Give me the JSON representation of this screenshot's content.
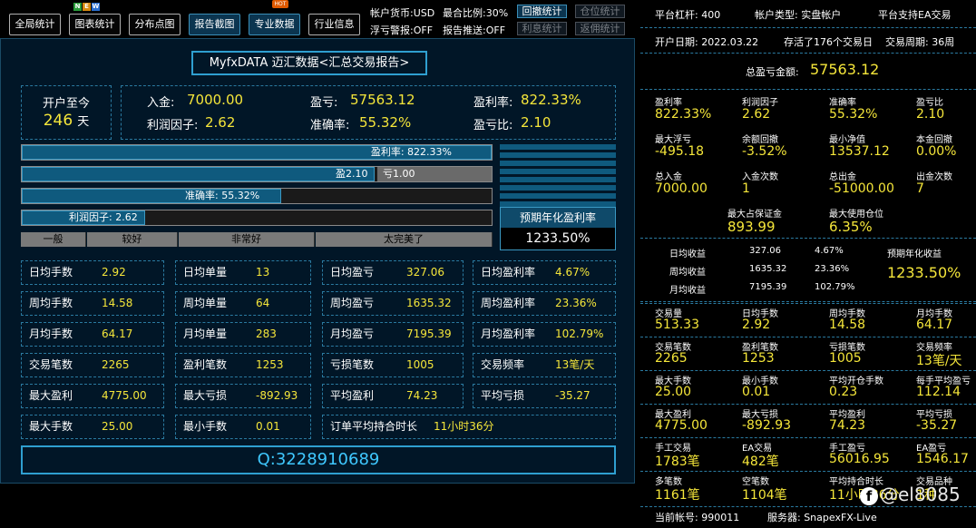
{
  "toolbar": {
    "buttons": [
      "全局统计",
      "图表统计",
      "分布点图",
      "报告截图",
      "专业数据",
      "行业信息"
    ],
    "new_badge": [
      "N",
      "E",
      "W"
    ],
    "hot_badge": "HOT",
    "account_currency": "帐户货币:USD",
    "max_ratio": "最合比例:30%",
    "float_alert": "浮亏警报:OFF",
    "report_push": "报告推送:OFF",
    "small_buttons": [
      "回撤统计",
      "仓位统计",
      "利息统计",
      "返佣统计"
    ]
  },
  "main": {
    "title": "MyfxDATA 迈汇数据<汇总交易报告>",
    "since_open_label": "开户至今",
    "days_value": "246",
    "days_unit": "天",
    "summary": {
      "deposit_label": "入金:",
      "deposit_value": "7000.00",
      "profit_label": "盈亏:",
      "profit_value": "57563.12",
      "profit_rate_label": "盈利率:",
      "profit_rate_value": "822.33%",
      "profit_factor_label": "利润因子:",
      "profit_factor_value": "2.62",
      "accuracy_label": "准确率:",
      "accuracy_value": "55.32%",
      "win_loss_label": "盈亏比:",
      "win_loss_value": "2.10"
    },
    "bars": {
      "profit_rate_text": "盈利率: 822.33%",
      "profit_rate_fill": 1.0,
      "win_text": "盈2.10",
      "loss_text": "亏1.00",
      "win_fill": 0.75,
      "accuracy_text": "准确率: 55.32%",
      "accuracy_fill": 0.553,
      "profit_factor_text": "利润因子: 2.62",
      "profit_factor_fill": 0.262
    },
    "grades": [
      "一般",
      "较好",
      "非常好",
      "太完美了"
    ],
    "annual": {
      "label": "预期年化盈利率",
      "value": "1233.50%"
    },
    "stats": [
      [
        [
          "日均手数",
          "2.92"
        ],
        [
          "日均单量",
          "13"
        ],
        [
          "日均盈亏",
          "327.06"
        ],
        [
          "日均盈利率",
          "4.67%"
        ]
      ],
      [
        [
          "周均手数",
          "14.58"
        ],
        [
          "周均单量",
          "64"
        ],
        [
          "周均盈亏",
          "1635.32"
        ],
        [
          "周均盈利率",
          "23.36%"
        ]
      ],
      [
        [
          "月均手数",
          "64.17"
        ],
        [
          "月均单量",
          "283"
        ],
        [
          "月均盈亏",
          "7195.39"
        ],
        [
          "月均盈利率",
          "102.79%"
        ]
      ],
      [
        [
          "交易笔数",
          "2265"
        ],
        [
          "盈利笔数",
          "1253"
        ],
        [
          "亏损笔数",
          "1005"
        ],
        [
          "交易频率",
          "13笔/天"
        ]
      ],
      [
        [
          "最大盈利",
          "4775.00"
        ],
        [
          "最大亏损",
          "-892.93"
        ],
        [
          "平均盈利",
          "74.23"
        ],
        [
          "平均亏损",
          "-35.27"
        ]
      ]
    ],
    "last_row": {
      "max_lots_label": "最大手数",
      "max_lots_value": "25.00",
      "min_lots_label": "最小手数",
      "min_lots_value": "0.01",
      "avg_hold_label": "订单平均持合时长",
      "avg_hold_value": "11小时36分"
    },
    "qq": "Q:3228910689"
  },
  "right": {
    "leverage": "平台杠杆: 400",
    "account_type": "帐户类型: 实盘帐户",
    "ea_support": "平台支持EA交易",
    "open_date": "开户日期: 2022.03.22",
    "survival": "存活了176个交易日",
    "period": "交易周期: 36周",
    "total_profit_label": "总盈亏金额:",
    "total_profit_value": "57563.12",
    "grid1": [
      [
        [
          "盈利率",
          "822.33%"
        ],
        [
          "利润因子",
          "2.62"
        ],
        [
          "准确率",
          "55.32%"
        ],
        [
          "盈亏比",
          "2.10"
        ]
      ],
      [
        [
          "最大浮亏",
          "-495.18"
        ],
        [
          "余额回撤",
          "-3.52%"
        ],
        [
          "最小净值",
          "13537.12"
        ],
        [
          "本金回撤",
          "0.00%"
        ]
      ],
      [
        [
          "总入金",
          "7000.00"
        ],
        [
          "入金次数",
          "1"
        ],
        [
          "总出金",
          "-51000.00"
        ],
        [
          "出金次数",
          "7"
        ]
      ]
    ],
    "margin_label": "最大占保证金",
    "margin_value": "893.99",
    "max_pos_label": "最大使用仓位",
    "max_pos_value": "6.35%",
    "earnings": [
      [
        "日均收益",
        "327.06",
        "4.67%"
      ],
      [
        "周均收益",
        "1635.32",
        "23.36%"
      ],
      [
        "月均收益",
        "7195.39",
        "102.79%"
      ]
    ],
    "annual_label": "预期年化收益",
    "annual_value": "1233.50%",
    "grid2": [
      [
        [
          "交易量",
          "513.33"
        ],
        [
          "日均手数",
          "2.92"
        ],
        [
          "周均手数",
          "14.58"
        ],
        [
          "月均手数",
          "64.17"
        ]
      ],
      [
        [
          "交易笔数",
          "2265"
        ],
        [
          "盈利笔数",
          "1253"
        ],
        [
          "亏损笔数",
          "1005"
        ],
        [
          "交易频率",
          "13笔/天"
        ]
      ],
      [
        [
          "最大手数",
          "25.00"
        ],
        [
          "最小手数",
          "0.01"
        ],
        [
          "平均开仓手数",
          "0.23"
        ],
        [
          "每手平均盈亏",
          "112.14"
        ]
      ],
      [
        [
          "最大盈利",
          "4775.00"
        ],
        [
          "最大亏损",
          "-892.93"
        ],
        [
          "平均盈利",
          "74.23"
        ],
        [
          "平均亏损",
          "-35.27"
        ]
      ],
      [
        [
          "手工交易",
          "1783笔"
        ],
        [
          "EA交易",
          "482笔"
        ],
        [
          "手工盈亏",
          "56016.95"
        ],
        [
          "EA盈亏",
          "1546.17"
        ]
      ],
      [
        [
          "多笔数",
          "1161笔"
        ],
        [
          "空笔数",
          "1104笔"
        ],
        [
          "平均持合时长",
          "11小时36分"
        ],
        [
          "交易品种",
          "1种"
        ]
      ]
    ],
    "account_no": "当前帐号: 990011",
    "server": "服务器: SnapexFX-Live"
  },
  "watermark": {
    "icon_letter": "f",
    "text": "@el8085"
  },
  "colors": {
    "accent": "#2f9fd0",
    "value": "#f5e63a",
    "bar": "#0f5a7e",
    "panel": "#011627"
  }
}
